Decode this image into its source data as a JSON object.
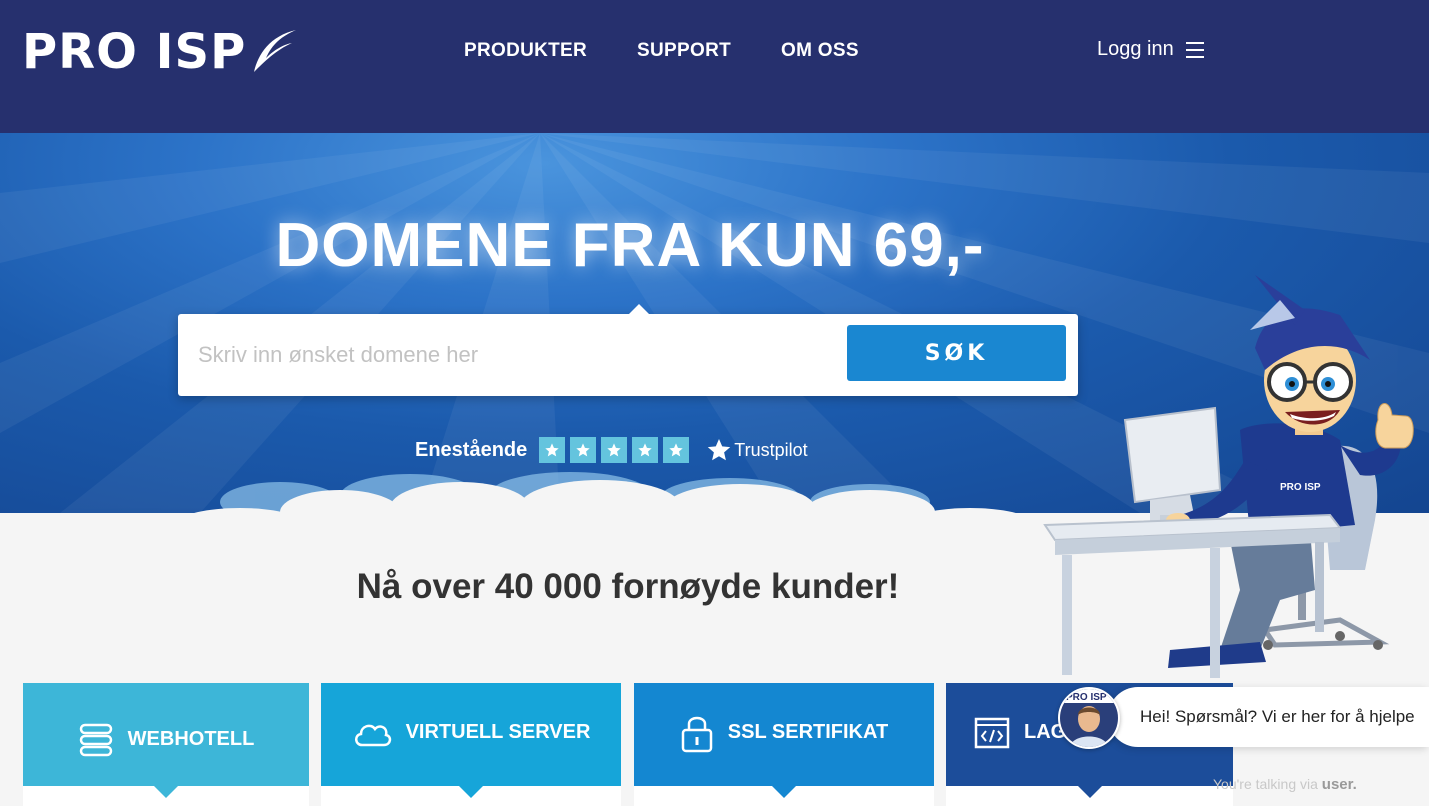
{
  "header": {
    "logo_text": "PRO ISP",
    "nav": [
      "PRODUKTER",
      "SUPPORT",
      "OM OSS"
    ],
    "login_label": "Logg inn"
  },
  "hero": {
    "title": "DOMENE FRA KUN 69,-",
    "search": {
      "placeholder": "Skriv inn ønsket domene her",
      "button_label": "SØK"
    },
    "trust": {
      "label": "Enestående",
      "stars": 5,
      "provider": "Trustpilot"
    }
  },
  "tagline": {
    "prefix": "Nå over ",
    "bold": "40 000 fornøyde kunder!"
  },
  "cards": [
    {
      "label": "WEBHOTELL",
      "icon": "server-stack-icon",
      "color": "#3db6d8"
    },
    {
      "label": "VIRTUELL SERVER",
      "icon": "cloud-icon",
      "color": "#16a5d9"
    },
    {
      "label": "SSL SERTIFIKAT",
      "icon": "lock-icon",
      "color": "#1487d1"
    },
    {
      "label": "LAG",
      "icon": "code-window-icon",
      "color": "#1c4d9a"
    }
  ],
  "mascot": {
    "shirt_text": "PRO ISP"
  },
  "chat": {
    "message": "Hei! Spørsmål? Vi er her for å hjelpe",
    "via_prefix": "You're talking via ",
    "via_brand": "user."
  },
  "colors": {
    "header_bg": "#26306e",
    "hero_accent": "#1a87d1",
    "star_bg": "#64c4de"
  }
}
